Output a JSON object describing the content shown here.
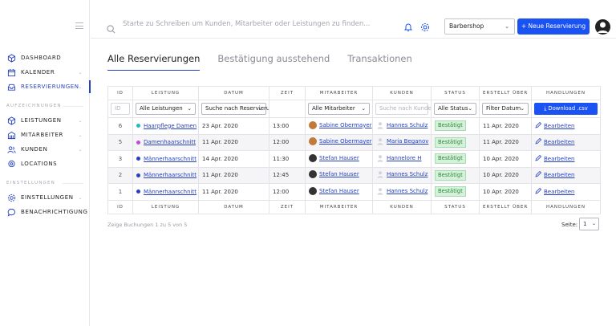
{
  "search": {
    "placeholder": "Starte zu Schreiben um Kunden, Mitarbeiter oder Leistungen zu finden..."
  },
  "header": {
    "shop": "Barbershop",
    "new_button": "+ Neue Reservierung"
  },
  "sidebar": {
    "items_top": [
      {
        "label": "DASHBOARD",
        "icon": "cube-icon"
      },
      {
        "label": "KALENDER",
        "icon": "calendar-icon",
        "chevron": true
      },
      {
        "label": "RESERVIERUNGEN",
        "icon": "inbox-icon",
        "chevron": true,
        "active": true
      }
    ],
    "section1": "AUFZEICHNUNGEN",
    "items_mid": [
      {
        "label": "LEISTUNGEN",
        "icon": "cube-icon",
        "chevron": true
      },
      {
        "label": "MITARBEITER",
        "icon": "building-icon",
        "chevron": true
      },
      {
        "label": "KUNDEN",
        "icon": "users-icon",
        "chevron": true
      },
      {
        "label": "LOCATIONS",
        "icon": "pin-icon"
      }
    ],
    "section2": "EINSTELLUNGEN",
    "items_bottom": [
      {
        "label": "EINSTELLUNGEN",
        "icon": "gear-icon",
        "chevron": true
      },
      {
        "label": "BENACHRICHTIGUNG",
        "icon": "chat-icon"
      }
    ]
  },
  "tabs": [
    "Alle Reservierungen",
    "Bestätigung ausstehend",
    "Transaktionen"
  ],
  "table": {
    "columns": [
      "ID",
      "LEISTUNG",
      "DATUM",
      "ZEIT",
      "MITARBEITER",
      "KUNDEN",
      "STATUS",
      "ERSTELLT ÜBER",
      "HANDLUNGEN"
    ],
    "filters": {
      "id_placeholder": "ID",
      "leistung": "Alle Leistungen",
      "datum": "Suche nach Reservierungsdatum",
      "mitarbeiter": "Alle Mitarbeiter",
      "kunden_placeholder": "Suche nach Kunde",
      "status": "Alle Status",
      "erstellt": "Filter Datum",
      "download": "Download .csv"
    },
    "rows": [
      {
        "id": "6",
        "service": "Haarpflege Damen",
        "service_color": "#29b6c9",
        "date": "23 Apr. 2020",
        "time": "13:00",
        "staff": "Sabine Obermayer",
        "staff_avatar": "#c07a3a",
        "customer": "Hannes Schulz",
        "status": "Bestätigt",
        "created": "11 Apr. 2020",
        "action": "Bearbeiten"
      },
      {
        "id": "5",
        "service": "Damenhaarschnitt",
        "service_color": "#c04fd8",
        "date": "11 Apr. 2020",
        "time": "12:00",
        "staff": "Sabine Obermayer",
        "staff_avatar": "#c07a3a",
        "customer": "Maria Beganov",
        "status": "Bestätigt",
        "created": "11 Apr. 2020",
        "action": "Bearbeiten"
      },
      {
        "id": "3",
        "service": "Männerhaarschnitt",
        "service_color": "#2541c2",
        "date": "14 Apr. 2020",
        "time": "11:30",
        "staff": "Stefan Hauser",
        "staff_avatar": "#333333",
        "customer": "Hannelore H",
        "status": "Bestätigt",
        "created": "10 Apr. 2020",
        "action": "Bearbeiten"
      },
      {
        "id": "2",
        "service": "Männerhaarschnitt",
        "service_color": "#2541c2",
        "date": "11 Apr. 2020",
        "time": "12:45",
        "staff": "Stefan Hauser",
        "staff_avatar": "#333333",
        "customer": "Hannes Schulz",
        "status": "Bestätigt",
        "created": "10 Apr. 2020",
        "action": "Bearbeiten"
      },
      {
        "id": "1",
        "service": "Männerhaarschnitt",
        "service_color": "#2541c2",
        "date": "11 Apr. 2020",
        "time": "12:00",
        "staff": "Stefan Hauser",
        "staff_avatar": "#333333",
        "customer": "Hannes Schulz",
        "status": "Bestätigt",
        "created": "10 Apr. 2020",
        "action": "Bearbeiten"
      }
    ]
  },
  "footer": {
    "summary": "Zeige Buchungen 1 zu 5 von 5",
    "page_label": "Seite:",
    "page_value": "1"
  }
}
